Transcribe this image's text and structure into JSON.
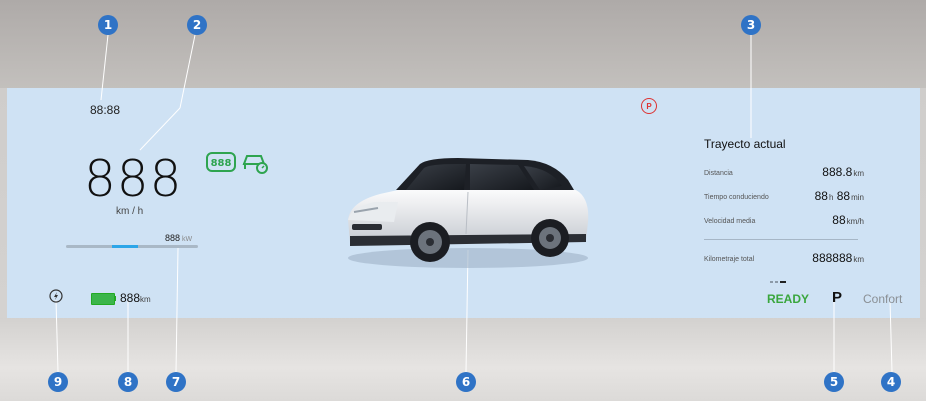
{
  "cluster": {
    "clock": "88:88",
    "speed": "888",
    "speed_unit": "km / h",
    "power_value": "888",
    "power_unit": "kW",
    "power_level": 0.55,
    "indicator_888": "888",
    "brake_symbol": "P"
  },
  "trip": {
    "title": "Trayecto actual",
    "rows": [
      {
        "label": "Distancia",
        "value": "888.8",
        "unit": "km"
      },
      {
        "label": "Tiempo conduciendo",
        "value_h": "88",
        "unit_h": "h",
        "value_m": "88",
        "unit_m": "min"
      },
      {
        "label": "Velocidad media",
        "value": "88",
        "unit": "km/h"
      },
      {
        "label": "Kilometraje total",
        "value": "888888",
        "unit": "km"
      }
    ],
    "page_dots": 3,
    "active_dot": 2
  },
  "status": {
    "ready": "READY",
    "gear": "P",
    "mode": "Confort",
    "range_value": "888",
    "range_unit": "km"
  },
  "callouts": [
    "1",
    "2",
    "3",
    "4",
    "5",
    "6",
    "7",
    "8",
    "9"
  ],
  "colors": {
    "panel": "#cfe2f4",
    "callout": "#2f73c6",
    "ready": "#3aa63d",
    "warning": "#dd3333",
    "accent": "#2da6e8"
  },
  "icons": [
    "speed-limit-indicator-icon",
    "driver-assist-car-icon",
    "parking-brake-icon",
    "eco-power-icon",
    "battery-icon",
    "vehicle-image"
  ]
}
